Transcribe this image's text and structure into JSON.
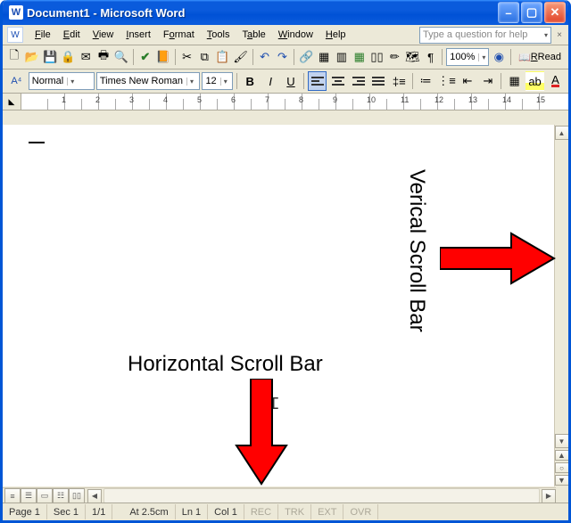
{
  "title": "Document1 - Microsoft Word",
  "menu": [
    "File",
    "Edit",
    "View",
    "Insert",
    "Format",
    "Tools",
    "Table",
    "Window",
    "Help"
  ],
  "help_placeholder": "Type a question for help",
  "toolbar": {
    "zoom": "100%",
    "read_label": "Read"
  },
  "format": {
    "style_label": "Normal",
    "font_label": "Times New Roman",
    "size_label": "12",
    "bold": "B",
    "italic": "I",
    "underline": "U"
  },
  "ruler": {
    "ticks": [
      "1",
      "2",
      "3",
      "4",
      "5",
      "6",
      "7",
      "8",
      "9",
      "10",
      "11",
      "12",
      "13",
      "14",
      "15"
    ]
  },
  "annotations": {
    "horizontal": "Horizontal Scroll Bar",
    "vertical": "Verical Scroll Bar"
  },
  "status": {
    "page": "Page  1",
    "sec": "Sec  1",
    "pages": "1/1",
    "at": "At  2.5cm",
    "ln": "Ln  1",
    "col": "Col  1",
    "rec": "REC",
    "trk": "TRK",
    "ext": "EXT",
    "ovr": "OVR"
  }
}
